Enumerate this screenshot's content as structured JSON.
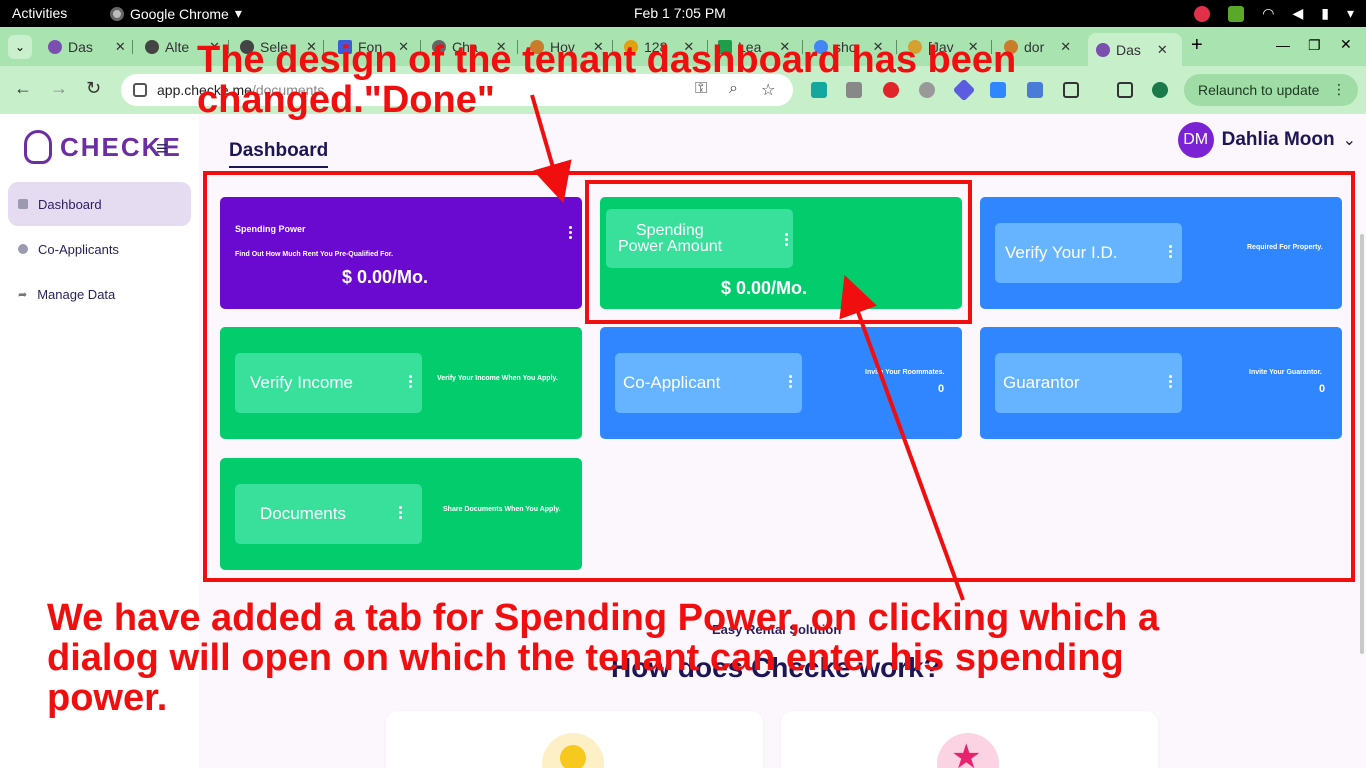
{
  "os": {
    "activities": "Activities",
    "app_name": "Google Chrome",
    "clock": "Feb 1   7:05 PM"
  },
  "browser": {
    "tabs": [
      {
        "label": "Das"
      },
      {
        "label": "Alte"
      },
      {
        "label": "Sele"
      },
      {
        "label": "Fon"
      },
      {
        "label": "Cha"
      },
      {
        "label": "Hov"
      },
      {
        "label": "128"
      },
      {
        "label": "Lea"
      },
      {
        "label": "sho"
      },
      {
        "label": "[Jav"
      },
      {
        "label": "dor"
      },
      {
        "label": "Das"
      }
    ],
    "url_host": "app.checke.me",
    "url_path": "/documents",
    "relaunch": "Relaunch to update"
  },
  "sidebar": {
    "logo": "CHECKE",
    "items": [
      {
        "label": "Dashboard"
      },
      {
        "label": "Co-Applicants"
      },
      {
        "label": "Manage Data"
      }
    ]
  },
  "header": {
    "breadcrumb": "Dashboard",
    "avatar_initials": "DM",
    "user_name": "Dahlia Moon"
  },
  "cards": {
    "spending_power": {
      "title": "Spending Power",
      "subtitle": "Find Out How Much Rent You Pre-Qualified For.",
      "amount": "$ 0.00/Mo."
    },
    "spending_amount": {
      "line1": "Spending",
      "line2": "Power Amount",
      "amount": "$ 0.00/Mo."
    },
    "verify_id": {
      "title": "Verify Your I.D.",
      "note": "Required For Property."
    },
    "verify_income": {
      "title": "Verify Income",
      "note": "Verify Your Income When You Apply."
    },
    "co_applicant": {
      "title": "Co-Applicant",
      "note": "Invite Your Roommates.",
      "count": "0"
    },
    "guarantor": {
      "title": "Guarantor",
      "note": "Invite Your Guarantor.",
      "count": "0"
    },
    "documents": {
      "title": "Documents",
      "note": "Share Documents When You Apply."
    }
  },
  "below": {
    "tagline": "Easy Rental Solution",
    "heading": "How does Checke work?"
  },
  "annotations": {
    "top": "The design of the tenant dashboard has been changed.\"Done\"",
    "bottom": "We have added a tab for Spending Power, on clicking which a dialog will open on which the tenant can enter his spending power."
  },
  "colors": {
    "purple": "#6a09d0",
    "green": "#02cc6b",
    "blue": "#2f86ff",
    "annotation_red": "#f00e0e"
  }
}
